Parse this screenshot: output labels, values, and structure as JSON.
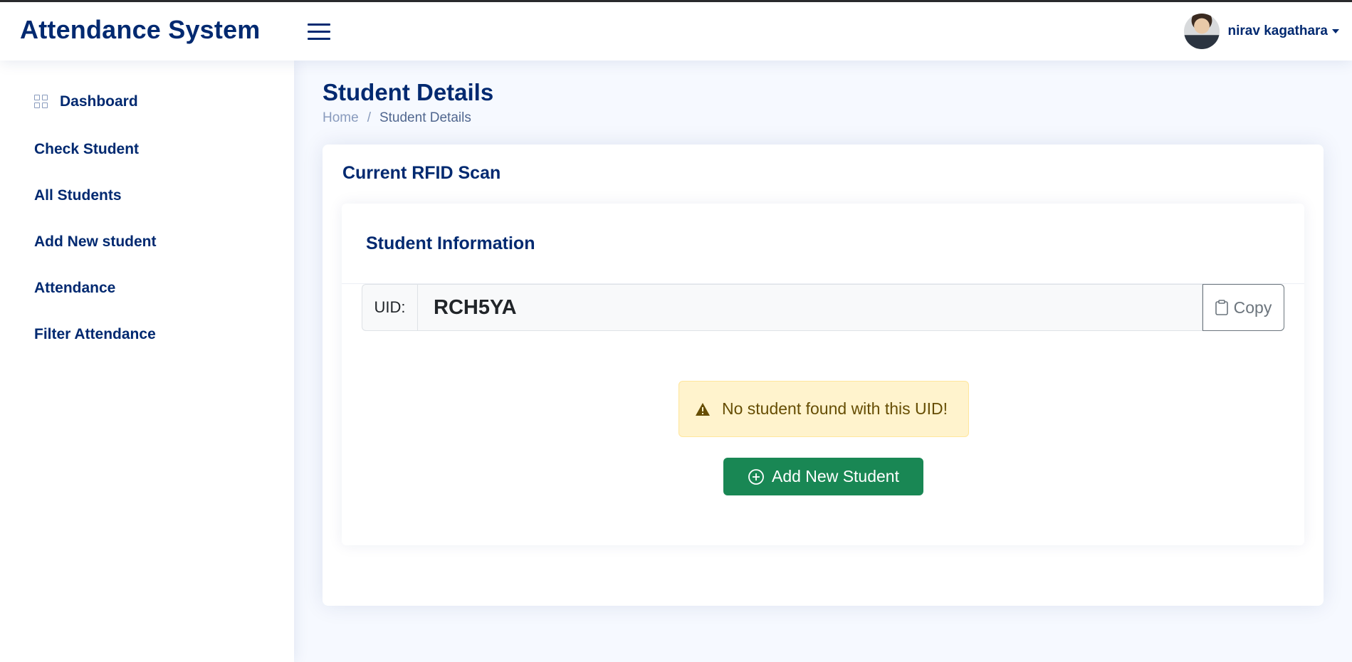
{
  "header": {
    "brand": "Attendance System",
    "menu_icon": "hamburger-menu-icon",
    "user": {
      "name": "nirav kagathara",
      "avatar": "user-avatar"
    }
  },
  "sidebar": {
    "items": [
      {
        "label": "Dashboard",
        "icon": "grid-icon"
      },
      {
        "label": "Check Student"
      },
      {
        "label": "All Students"
      },
      {
        "label": "Add New student"
      },
      {
        "label": "Attendance"
      },
      {
        "label": "Filter Attendance"
      }
    ]
  },
  "page": {
    "title": "Student Details",
    "breadcrumb": {
      "home": "Home",
      "separator": "/",
      "current": "Student Details"
    }
  },
  "scan_card": {
    "title": "Current RFID Scan",
    "info_title": "Student Information",
    "uid_label": "UID:",
    "uid_value": "RCH5YA",
    "copy_label": "Copy",
    "copy_icon": "clipboard-icon",
    "alert": {
      "text": "No student found with this UID!",
      "icon": "warning-triangle-icon",
      "color": "#fff3cd"
    },
    "add_button": {
      "label": "Add New Student",
      "icon": "plus-circle-icon",
      "color": "#198754"
    }
  },
  "colors": {
    "primary": "#012970",
    "background": "#f6f9ff"
  }
}
